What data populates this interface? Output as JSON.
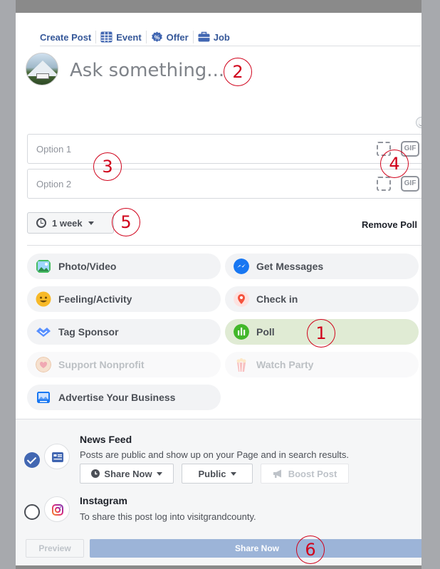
{
  "composer": {
    "tabs": [
      {
        "label": "Create Post",
        "icon": "create-post"
      },
      {
        "label": "Event",
        "icon": "calendar-icon"
      },
      {
        "label": "Offer",
        "icon": "percent-badge-icon"
      },
      {
        "label": "Job",
        "icon": "briefcase-icon"
      }
    ],
    "placeholder": "Ask something...",
    "option1_placeholder": "Option 1",
    "option2_placeholder": "Option 2",
    "gif_label": "GIF",
    "duration": "1 week",
    "remove_poll": "Remove Poll"
  },
  "actions": [
    {
      "label": "Photo/Video",
      "icon": "photo-icon",
      "color": "#45bd62"
    },
    {
      "label": "Get Messages",
      "icon": "messenger-icon",
      "color": "#1877f2"
    },
    {
      "label": "Feeling/Activity",
      "icon": "smiley-icon",
      "color": "#f7b928"
    },
    {
      "label": "Check in",
      "icon": "location-pin-icon",
      "color": "#f5533d"
    },
    {
      "label": "Tag Sponsor",
      "icon": "handshake-icon",
      "color": "#5890ff"
    },
    {
      "label": "Poll",
      "icon": "poll-icon",
      "color": "#42b72a"
    },
    {
      "label": "Support Nonprofit",
      "icon": "heart-badge-icon",
      "color": "#f0c5a8"
    },
    {
      "label": "Watch Party",
      "icon": "popcorn-icon",
      "color": "#f7a7a7"
    },
    {
      "label": "Advertise Your Business",
      "icon": "ad-icon",
      "color": "#1877f2"
    }
  ],
  "destinations": {
    "news_feed": {
      "title": "News Feed",
      "description": "Posts are public and show up on your Page and in search results.",
      "share_now": "Share Now",
      "audience": "Public",
      "boost": "Boost Post"
    },
    "instagram": {
      "title": "Instagram",
      "description": "To share this post log into visitgrandcounty."
    }
  },
  "footer": {
    "preview": "Preview",
    "share_now": "Share Now"
  },
  "annotations": [
    "1",
    "2",
    "3",
    "4",
    "5",
    "6"
  ],
  "colors": {
    "link": "#365899",
    "primary": "#4267b2",
    "annotation": "#d0021b",
    "poll_active": "#e0ebd4"
  }
}
